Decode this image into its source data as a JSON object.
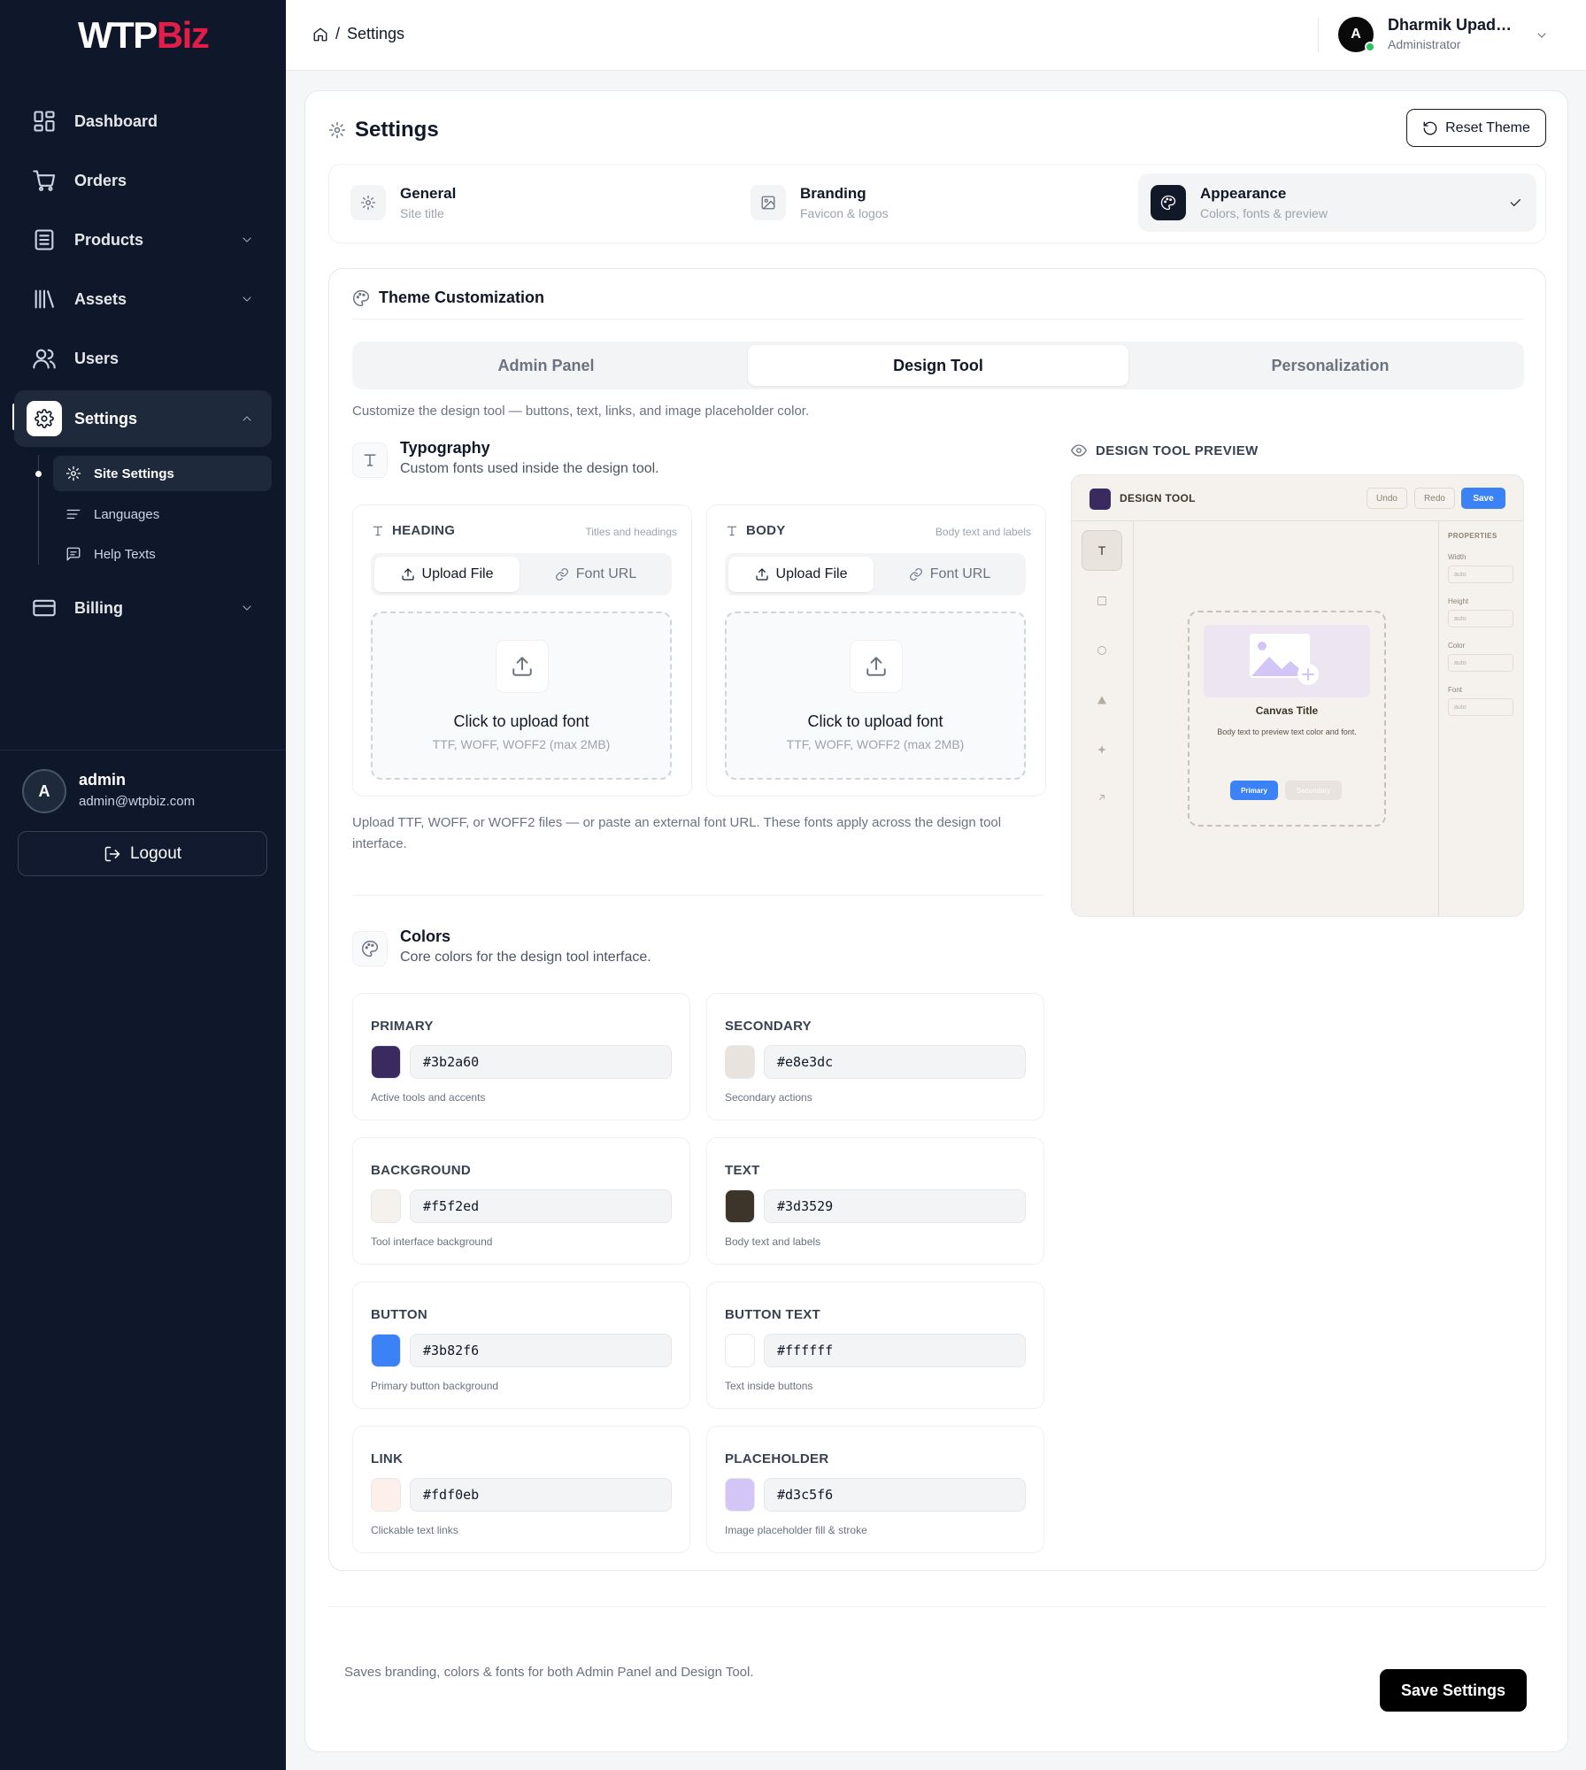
{
  "sidebar": {
    "logo_a": "WTP",
    "logo_b": "Biz",
    "items": [
      {
        "label": "Dashboard",
        "icon": "dashboard-icon"
      },
      {
        "label": "Orders",
        "icon": "cart-icon"
      },
      {
        "label": "Products",
        "icon": "products-icon"
      },
      {
        "label": "Assets",
        "icon": "library-icon"
      },
      {
        "label": "Users",
        "icon": "users-icon"
      },
      {
        "label": "Settings",
        "icon": "gear-icon"
      },
      {
        "label": "Billing",
        "icon": "credit-card-icon"
      }
    ],
    "subitems": [
      {
        "label": "Site Settings",
        "icon": "gear-icon"
      },
      {
        "label": "Languages",
        "icon": "text-lines-icon"
      },
      {
        "label": "Help Texts",
        "icon": "message-icon"
      }
    ],
    "user": {
      "initial": "A",
      "name": "admin",
      "email": "admin@wtpbiz.com"
    },
    "logout_label": "Logout"
  },
  "topbar": {
    "breadcrumb": "Settings",
    "user_initial": "A",
    "user_name": "Dharmik Upadhyay",
    "user_role": "Administrator"
  },
  "page": {
    "title": "Settings",
    "reset_label": "Reset Theme",
    "steps": [
      {
        "title": "General",
        "sub": "Site title"
      },
      {
        "title": "Branding",
        "sub": "Favicon & logos"
      },
      {
        "title": "Appearance",
        "sub": "Colors, fonts & preview"
      }
    ]
  },
  "theme": {
    "title": "Theme Customization",
    "tabs": [
      "Admin Panel",
      "Design Tool",
      "Personalization"
    ],
    "active_tab": "Design Tool",
    "description": "Customize the design tool — buttons, text, links, and image placeholder color.",
    "typography": {
      "title": "Typography",
      "sub": "Custom fonts used inside the design tool.",
      "boxes": [
        {
          "label": "HEADING",
          "hint": "Titles and headings"
        },
        {
          "label": "BODY",
          "hint": "Body text and labels"
        }
      ],
      "upload_label": "Upload File",
      "url_label": "Font URL",
      "drop_title": "Click to upload font",
      "drop_sub": "TTF, WOFF, WOFF2 (max 2MB)",
      "note": "Upload TTF, WOFF, or WOFF2 files — or paste an external font URL. These fonts apply across the design tool interface."
    },
    "colors": {
      "title": "Colors",
      "sub": "Core colors for the design tool interface.",
      "items": [
        {
          "label": "PRIMARY",
          "hex": "#3b2a60",
          "desc": "Active tools and accents"
        },
        {
          "label": "SECONDARY",
          "hex": "#e8e3dc",
          "desc": "Secondary actions"
        },
        {
          "label": "BACKGROUND",
          "hex": "#f5f2ed",
          "desc": "Tool interface background"
        },
        {
          "label": "TEXT",
          "hex": "#3d3529",
          "desc": "Body text and labels"
        },
        {
          "label": "BUTTON",
          "hex": "#3b82f6",
          "desc": "Primary button background"
        },
        {
          "label": "BUTTON TEXT",
          "hex": "#ffffff",
          "desc": "Text inside buttons"
        },
        {
          "label": "LINK",
          "hex": "#fdf0eb",
          "desc": "Clickable text links"
        },
        {
          "label": "PLACEHOLDER",
          "hex": "#d3c5f6",
          "desc": "Image placeholder fill & stroke"
        }
      ]
    },
    "preview": {
      "label": "DESIGN TOOL PREVIEW",
      "title": "DESIGN TOOL",
      "undo": "Undo",
      "redo": "Redo",
      "save": "Save",
      "tool_t": "T",
      "properties": "PROPERTIES",
      "props": [
        {
          "label": "Width",
          "value": "auto"
        },
        {
          "label": "Height",
          "value": "auto"
        },
        {
          "label": "Color",
          "value": "auto"
        },
        {
          "label": "Font",
          "value": "auto"
        }
      ],
      "canvas_title": "Canvas Title",
      "canvas_body": "Body text to preview text color and font.",
      "primary": "Primary",
      "secondary": "Secondary"
    }
  },
  "footer": {
    "note": "Saves branding, colors & fonts for both Admin Panel and Design Tool.",
    "save_label": "Save Settings"
  }
}
